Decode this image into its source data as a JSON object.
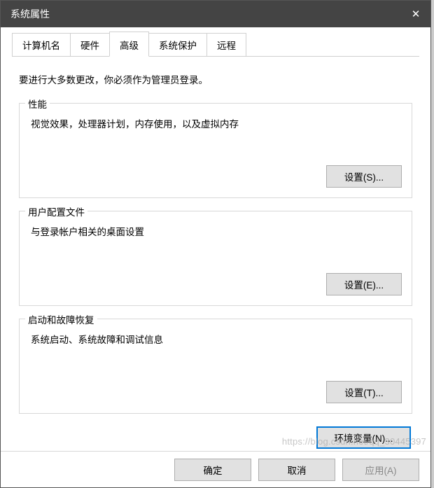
{
  "titlebar": {
    "title": "系统属性"
  },
  "tabs": {
    "computer_name": "计算机名",
    "hardware": "硬件",
    "advanced": "高级",
    "system_protection": "系统保护",
    "remote": "远程"
  },
  "panel": {
    "admin_note": "要进行大多数更改，你必须作为管理员登录。",
    "performance": {
      "title": "性能",
      "desc": "视觉效果，处理器计划，内存使用，以及虚拟内存",
      "settings_btn": "设置(S)..."
    },
    "user_profiles": {
      "title": "用户配置文件",
      "desc": "与登录帐户相关的桌面设置",
      "settings_btn": "设置(E)..."
    },
    "startup_recovery": {
      "title": "启动和故障恢复",
      "desc": "系统启动、系统故障和调试信息",
      "settings_btn": "设置(T)..."
    },
    "env_vars_btn": "环境变量(N)..."
  },
  "bottom": {
    "ok": "确定",
    "cancel": "取消",
    "apply": "应用(A)"
  },
  "watermark": "https://blog.csdn.net/qq_30445397"
}
